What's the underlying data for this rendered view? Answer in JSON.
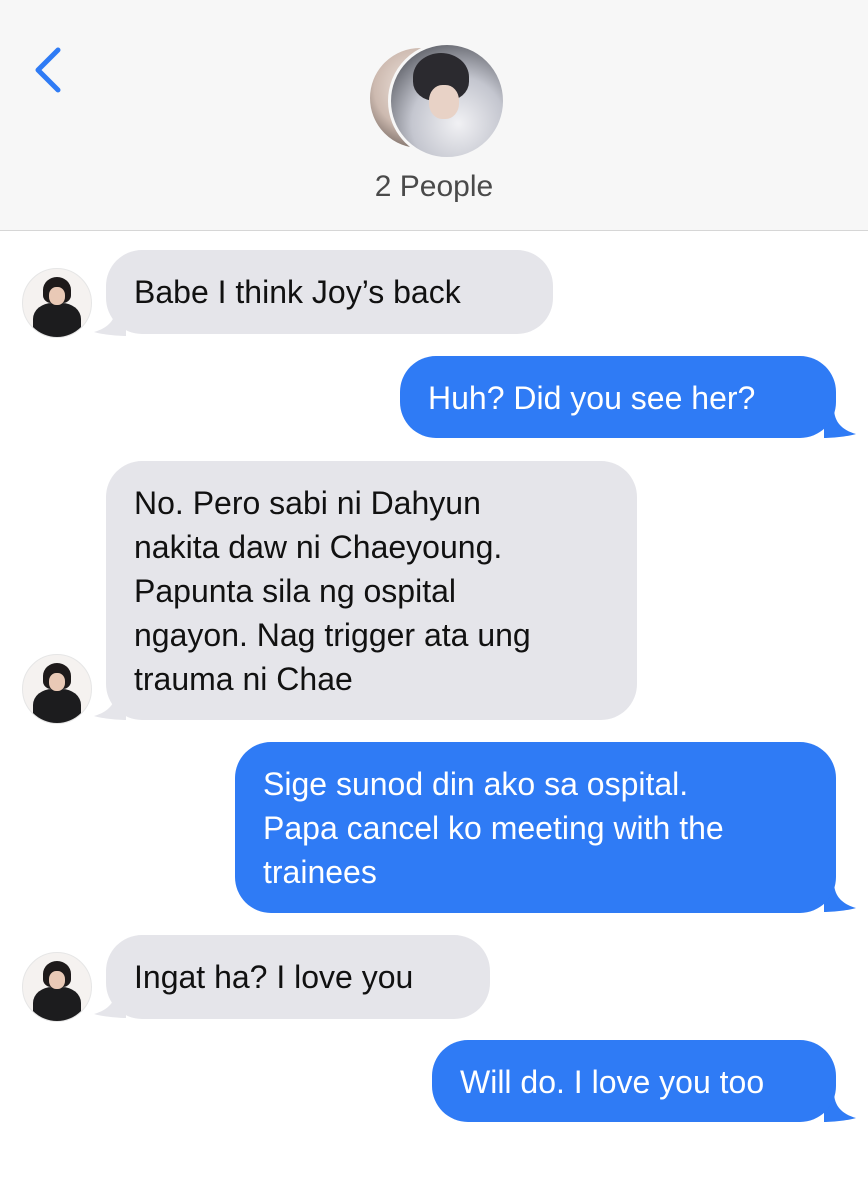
{
  "header": {
    "title": "2 People"
  },
  "messages": [
    {
      "direction": "incoming",
      "text": "Babe I think Joy’s back"
    },
    {
      "direction": "outgoing",
      "text": "Huh? Did you see her?"
    },
    {
      "direction": "incoming",
      "text": "No. Pero sabi ni Dahyun\nnakita daw ni Chaeyoung.\nPapunta sila ng ospital\nngayon. Nag trigger ata ung\ntrauma ni Chae"
    },
    {
      "direction": "outgoing",
      "text": "Sige sunod din ako sa ospital.\nPapa cancel ko meeting with the\ntrainees"
    },
    {
      "direction": "incoming",
      "text": "Ingat ha? I love you"
    },
    {
      "direction": "outgoing",
      "text": "Will do. I love you too"
    }
  ],
  "colors": {
    "incoming_bubble": "#e5e5ea",
    "outgoing_bubble": "#2f7bf5",
    "accent": "#2f7bf5",
    "header_bg": "#f7f7f7"
  }
}
